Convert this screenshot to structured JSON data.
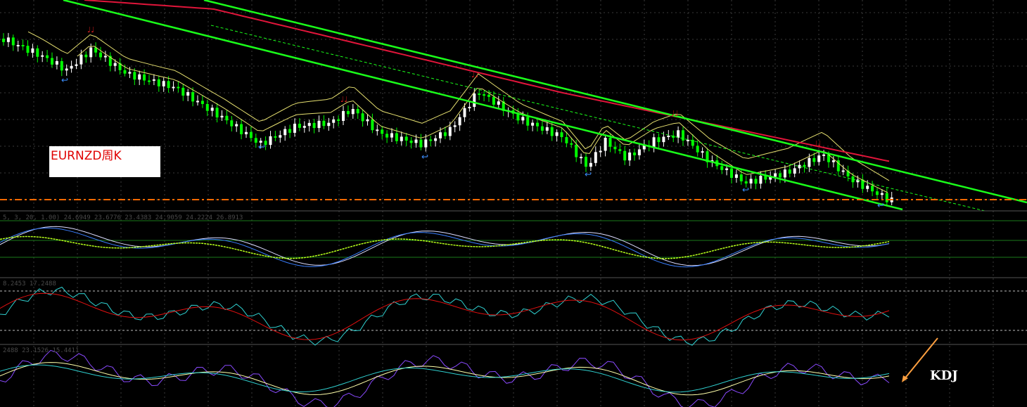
{
  "labels": {
    "chart_title": "EURNZD周K",
    "kdj": "KDJ",
    "stoch_readout": "5, 3, 20, 1.00) 24.6949 23.6776 23.4383 24.9059 24.2224 26.8913",
    "rsi_readout": "8.2453 17.2488",
    "kdj_readout": "2488 23.1526 15.4411"
  },
  "colors": {
    "background": "#000000",
    "grid": "#3a3a3a",
    "bull_candle": "#ffffff",
    "bear_candle": "#00ff00",
    "channel": "#1aff1a",
    "ma_red": "#e0153a",
    "ma_yellow": "#e6e070",
    "support_line": "#ff6a00",
    "fractal_up": "#e02020",
    "fractal_down": "#3b8fff",
    "stoch_main": "#dcdcff",
    "stoch_blue": "#3a7fff",
    "stoch_green": "#b6ff1a",
    "rsi_cyan": "#2fd0d0",
    "rsi_red": "#e01010",
    "kdj_k": "#ffffaa",
    "kdj_d": "#2fd0d0",
    "kdj_j": "#8a4aff",
    "arrow": "#ffa040"
  },
  "chart_data": {
    "type": "candlestick",
    "title": "EURNZD周K",
    "y_trend_start": 1.0,
    "y_trend_end": 0.0,
    "oscillator_panes": [
      "stochastic",
      "rsi-like",
      "KDJ"
    ],
    "kdj_label": "KDJ"
  }
}
